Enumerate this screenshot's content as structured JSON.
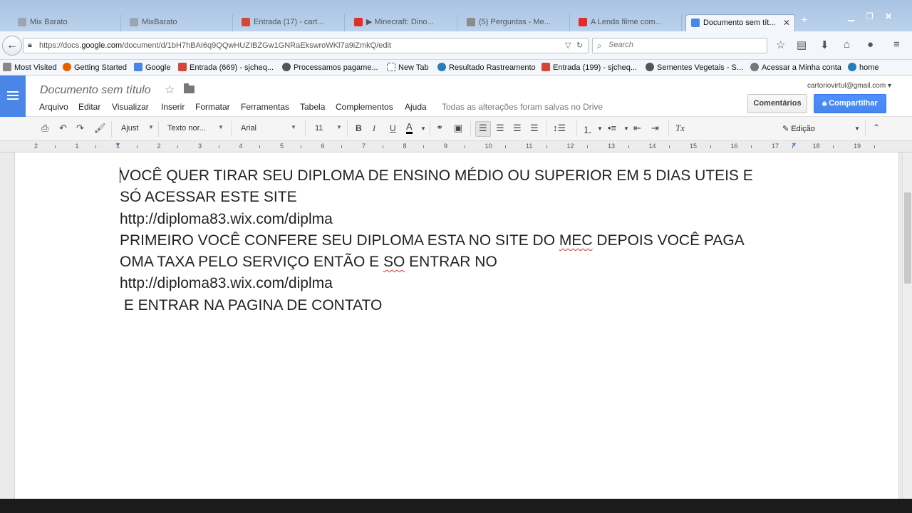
{
  "browser": {
    "tabs": [
      {
        "title": "Mix Barato",
        "icon_color": "#9aa6b5"
      },
      {
        "title": "MixBarato",
        "icon_color": "#9aa6b5"
      },
      {
        "title": "Entrada (17) - cart...",
        "icon_color": "#d44638"
      },
      {
        "title": "▶ Minecraft: Dino...",
        "icon_color": "#e52d27"
      },
      {
        "title": "(5) Perguntas - Me...",
        "icon_color": "#8c8c8c"
      },
      {
        "title": "A Lenda filme com...",
        "icon_color": "#e52d27"
      },
      {
        "title": "Documento sem tít...",
        "icon_color": "#4a86e8"
      }
    ],
    "url_prefix": "https://docs.",
    "url_domain": "google.com",
    "url_path": "/document/d/1bH7hBAI6q9QQwHUZIBZGw1GNRaEkswroWKl7a9iZmkQ/edit",
    "search_placeholder": "Search"
  },
  "bookmarks": [
    {
      "label": "Most Visited",
      "icon_color": "#888"
    },
    {
      "label": "Getting Started",
      "icon_color": "#e66000"
    },
    {
      "label": "Google",
      "icon_color": "#4a86e8"
    },
    {
      "label": "Entrada (669) - sjcheq...",
      "icon_color": "#d44638"
    },
    {
      "label": "Processamos pagame...",
      "icon_color": "#555"
    },
    {
      "label": "New Tab",
      "icon_color": "#ffffff"
    },
    {
      "label": "Resultado Rastreamento",
      "icon_color": "#2b7bb9"
    },
    {
      "label": "Entrada (199) - sjcheq...",
      "icon_color": "#d44638"
    },
    {
      "label": "Sementes Vegetais - S...",
      "icon_color": "#555"
    },
    {
      "label": "Acessar a Minha conta",
      "icon_color": "#777"
    },
    {
      "label": "home",
      "icon_color": "#2b7bb9"
    }
  ],
  "docs": {
    "title": "Documento sem título",
    "menu": [
      "Arquivo",
      "Editar",
      "Visualizar",
      "Inserir",
      "Formatar",
      "Ferramentas",
      "Tabela",
      "Complementos",
      "Ajuda"
    ],
    "save_status": "Todas as alterações foram salvas no Drive",
    "account": "cartoriovirtul@gmail.com",
    "comments_label": "Comentários",
    "share_label": "Compartilhar",
    "accent_color": "#4a86e8"
  },
  "toolbar": {
    "zoom": "Ajust",
    "style": "Texto nor...",
    "font": "Arial",
    "size": "11",
    "mode": "Edição"
  },
  "ruler_numbers": [
    "2",
    "1",
    "1",
    "2",
    "3",
    "4",
    "5",
    "6",
    "7",
    "8",
    "9",
    "10",
    "11",
    "12",
    "13",
    "14",
    "15",
    "16",
    "17",
    "18",
    "19"
  ],
  "document": {
    "lines": [
      "VOCÊ QUER TIRAR SEU DIPLOMA DE ENSINO MÉDIO OU SUPERIOR EM 5 DIAS UTEIS E",
      "SÓ ACESSAR ESTE SITE",
      "http://diploma83.wix.com/diplma",
      "PRIMEIRO VOCÊ CONFERE SEU DIPLOMA ESTA NO SITE DO ",
      "MEC",
      " DEPOIS VOCÊ PAGA",
      "OMA TAXA PELO SERVIÇO ENTÃO E ",
      "SO",
      " ENTRAR NO",
      "http://diploma83.wix.com/diplma",
      " E ENTRAR NA PAGINA DE CONTATO"
    ]
  }
}
